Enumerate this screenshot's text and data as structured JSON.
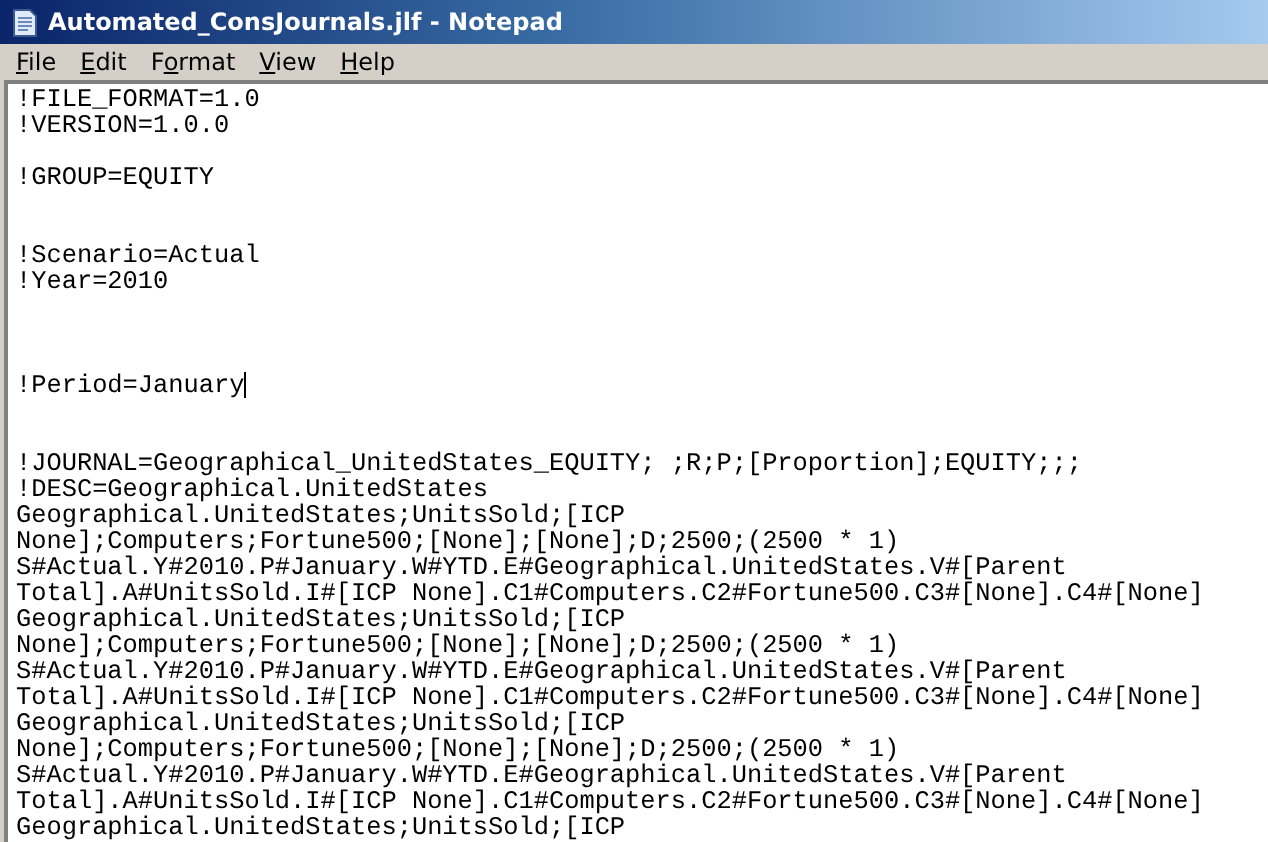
{
  "window": {
    "title": "Automated_ConsJournals.jlf - Notepad"
  },
  "menu": [
    {
      "key": "F",
      "rest": "ile"
    },
    {
      "key": "E",
      "rest": "dit"
    },
    {
      "before": "F",
      "key": "o",
      "rest": "rmat"
    },
    {
      "key": "V",
      "rest": "iew"
    },
    {
      "key": "H",
      "rest": "elp"
    }
  ],
  "editor": {
    "lines": [
      {
        "kind": "text",
        "text": "!FILE_FORMAT=1.0"
      },
      {
        "kind": "text",
        "text": "!VERSION=1.0.0"
      },
      {
        "kind": "blank"
      },
      {
        "kind": "text",
        "text": "!GROUP=EQUITY"
      },
      {
        "kind": "blank"
      },
      {
        "kind": "blank"
      },
      {
        "kind": "text",
        "text": "!Scenario=Actual"
      },
      {
        "kind": "text",
        "text": "!Year=2010"
      },
      {
        "kind": "blank"
      },
      {
        "kind": "blank"
      },
      {
        "kind": "blank"
      },
      {
        "kind": "text",
        "text": "!Period=January",
        "caret": true
      },
      {
        "kind": "blank"
      },
      {
        "kind": "blank"
      },
      {
        "kind": "text",
        "text": "!JOURNAL=Geographical_UnitedStates_EQUITY; ;R;P;[Proportion];EQUITY;;;"
      },
      {
        "kind": "text",
        "text": "!DESC=Geographical.UnitedStates"
      },
      {
        "kind": "text",
        "text": "Geographical.UnitedStates;UnitsSold;[ICP"
      },
      {
        "kind": "text",
        "text": "None];Computers;Fortune500;[None];[None];D;2500;(2500 * 1)"
      },
      {
        "kind": "text",
        "text": "S#Actual.Y#2010.P#January.W#YTD.E#Geographical.UnitedStates.V#[Parent"
      },
      {
        "kind": "text",
        "text": "Total].A#UnitsSold.I#[ICP None].C1#Computers.C2#Fortune500.C3#[None].C4#[None]"
      },
      {
        "kind": "text",
        "text": "Geographical.UnitedStates;UnitsSold;[ICP"
      },
      {
        "kind": "text",
        "text": "None];Computers;Fortune500;[None];[None];D;2500;(2500 * 1)"
      },
      {
        "kind": "text",
        "text": "S#Actual.Y#2010.P#January.W#YTD.E#Geographical.UnitedStates.V#[Parent"
      },
      {
        "kind": "text",
        "text": "Total].A#UnitsSold.I#[ICP None].C1#Computers.C2#Fortune500.C3#[None].C4#[None]"
      },
      {
        "kind": "text",
        "text": "Geographical.UnitedStates;UnitsSold;[ICP"
      },
      {
        "kind": "text",
        "text": "None];Computers;Fortune500;[None];[None];D;2500;(2500 * 1)"
      },
      {
        "kind": "text",
        "text": "S#Actual.Y#2010.P#January.W#YTD.E#Geographical.UnitedStates.V#[Parent"
      },
      {
        "kind": "text",
        "text": "Total].A#UnitsSold.I#[ICP None].C1#Computers.C2#Fortune500.C3#[None].C4#[None]"
      },
      {
        "kind": "text",
        "text": "Geographical.UnitedStates;UnitsSold;[ICP"
      }
    ]
  }
}
